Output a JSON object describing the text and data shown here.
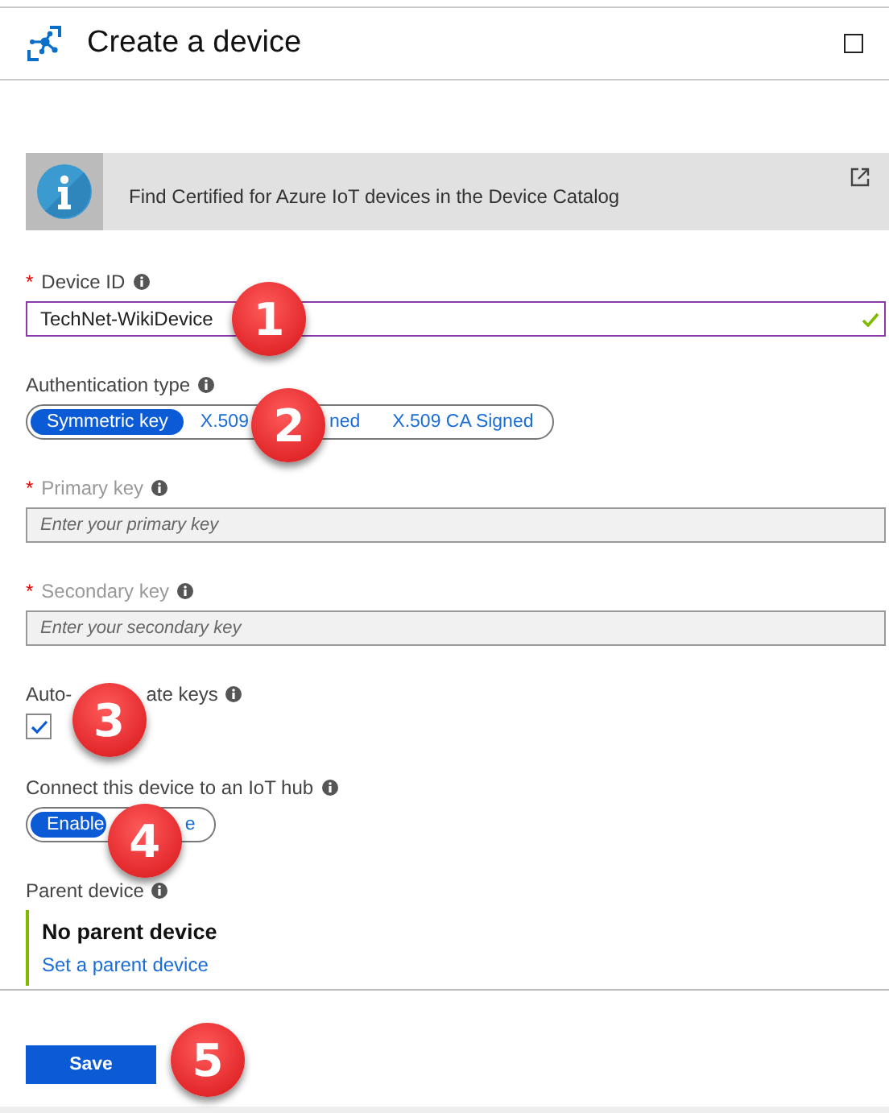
{
  "header": {
    "title": "Create a device"
  },
  "banner": {
    "text": "Find Certified for Azure IoT devices in the Device Catalog"
  },
  "fields": [
    {
      "kind": "text",
      "marker": "*",
      "label": [
        "Device ID"
      ],
      "value": "TechNet-WikiDevice",
      "valid": true,
      "disabled": false,
      "callout": "1"
    },
    {
      "kind": "segmented",
      "label": [
        "Authentication type"
      ],
      "options": [
        {
          "parts": [
            "Symmetric key"
          ],
          "selected": true
        },
        {
          "parts": [
            "X.509",
            {
              "callout": "2"
            },
            "ned"
          ],
          "selected": false
        },
        {
          "parts": [
            "X.509 CA Signed"
          ],
          "selected": false
        }
      ]
    },
    {
      "kind": "text",
      "marker": "*",
      "label": [
        "Primary key"
      ],
      "placeholder": "Enter your primary key",
      "disabled": true
    },
    {
      "kind": "text",
      "marker": "*",
      "label": [
        "Secondary key"
      ],
      "placeholder": "Enter your secondary key",
      "disabled": true
    },
    {
      "kind": "checkbox",
      "label": [
        "Auto-",
        {
          "callout": "3"
        },
        "ate keys"
      ],
      "checked": true
    },
    {
      "kind": "segmented",
      "label": [
        "Connect this device to an IoT hub"
      ],
      "options": [
        {
          "parts": [
            "Enable"
          ],
          "selected": true
        },
        {
          "parts": [
            {
              "callout": "4"
            },
            "e"
          ],
          "selected": false
        }
      ]
    },
    {
      "kind": "parent",
      "label": [
        "Parent device"
      ],
      "value": "No parent device",
      "link": "Set a parent device"
    }
  ],
  "save": {
    "label": "Save",
    "callout": "5"
  }
}
